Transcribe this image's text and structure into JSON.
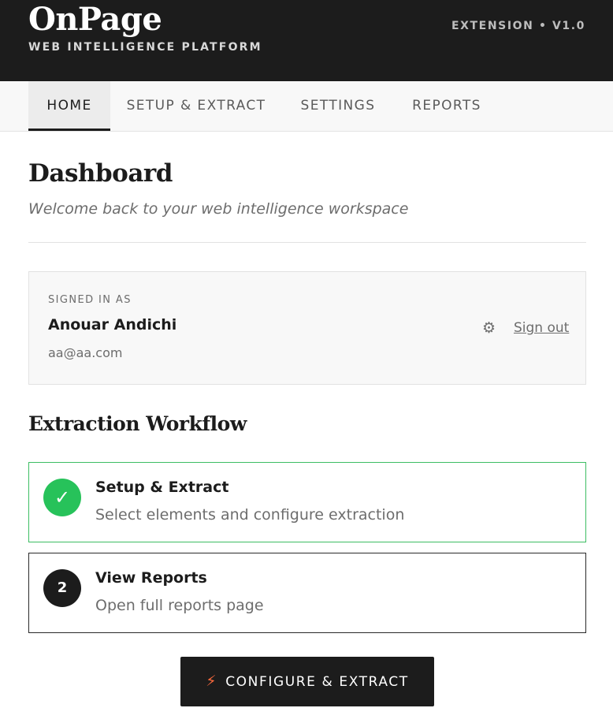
{
  "header": {
    "brand": "OnPage",
    "tagline": "WEB INTELLIGENCE PLATFORM",
    "version": "EXTENSION • V1.0"
  },
  "tabs": [
    {
      "label": "HOME",
      "active": true
    },
    {
      "label": "SETUP & EXTRACT",
      "active": false
    },
    {
      "label": "SETTINGS",
      "active": false
    },
    {
      "label": "REPORTS",
      "active": false
    }
  ],
  "page": {
    "title": "Dashboard",
    "subtitle": "Welcome back to your web intelligence workspace"
  },
  "account": {
    "label": "SIGNED IN AS",
    "name": "Anouar Andichi",
    "email": "aa@aa.com",
    "settings_icon": "gear-icon",
    "sign_out": "Sign out"
  },
  "workflow": {
    "title": "Extraction Workflow",
    "steps": [
      {
        "badge": "✓",
        "title": "Setup & Extract",
        "description": "Select elements and configure extraction",
        "status": "done"
      },
      {
        "badge": "2",
        "title": "View Reports",
        "description": "Open full reports page",
        "status": "pending"
      }
    ]
  },
  "cta": {
    "icon": "bolt-icon",
    "label": "CONFIGURE & EXTRACT"
  },
  "colors": {
    "header_bg": "#1c1c1c",
    "success": "#27c25a",
    "accent": "#ff6a3d"
  }
}
